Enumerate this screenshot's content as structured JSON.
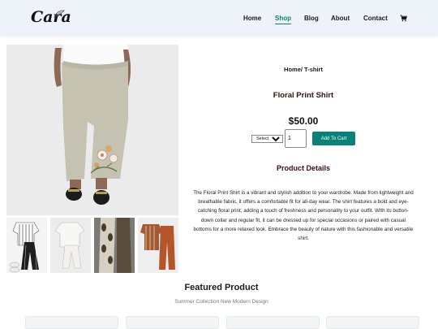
{
  "header": {
    "logo": "Cara",
    "nav": [
      {
        "label": "Home",
        "active": false
      },
      {
        "label": "Shop",
        "active": true
      },
      {
        "label": "Blog",
        "active": false
      },
      {
        "label": "About",
        "active": false
      },
      {
        "label": "Contact",
        "active": false
      }
    ],
    "cart_icon": "cart-icon",
    "accent": "#088178"
  },
  "product": {
    "breadcrumb": "Home/ T-shirt",
    "title": "Floral Print Shirt",
    "price": "$50.00",
    "size_select": {
      "selected": "Select Size",
      "options": [
        "Select Size"
      ]
    },
    "quantity": "1",
    "add_to_cart": "Add To Cart",
    "details_heading": "Product Details",
    "description": "The Floral Print Shirt is a vibrant and stylish addition to your wardrobe. Made from lightweight and breathable fabric, it offers a comfortable fit for all-day wear. The shirt features a bold and eye-catching floral print, adding a touch of freshness and personality to your outfit. With its button-down collar and regular fit, it can be dressed up for special occasions or paired with casual bottoms for a more relaxed look. Embrace the beauty of nature with this fashionable and versatile shirt."
  },
  "featured": {
    "title": "Featured Product",
    "subtitle": "Summer Collection New Modern Design"
  }
}
